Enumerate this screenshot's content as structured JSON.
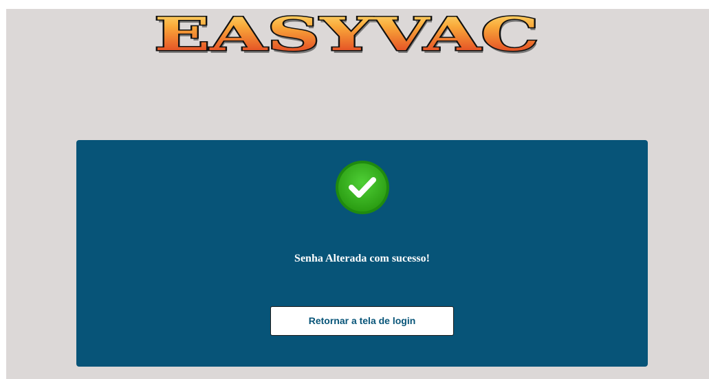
{
  "logo": {
    "text": "EASYVAC"
  },
  "status": {
    "icon": "check-circle-icon",
    "message": "Senha Alterada com sucesso!"
  },
  "actions": {
    "return_label": "Retornar a tela de login"
  },
  "colors": {
    "page_background": "#dcd8d7",
    "card_background": "#075478",
    "success_green": "#2fa317",
    "logo_gradient_top": "#fbd34a",
    "logo_gradient_bottom": "#e3341c"
  }
}
